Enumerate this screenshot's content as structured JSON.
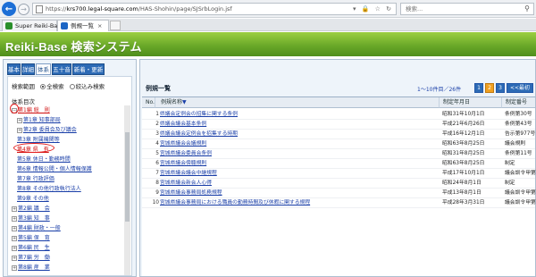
{
  "browser": {
    "url_prefix": "https://",
    "url_domain": "krs700.legal-square.com",
    "url_path": "/HAS-Shohin/page/SJSrbLogin.jsf",
    "url_tools": "▾ 🔒 ☆ ↻",
    "search_placeholder": "検索...",
    "tabs": [
      {
        "label": "Super Reiki-Base",
        "fav_color": "#2a8f2a"
      },
      {
        "label": "例規一覧",
        "fav_color": "#1c65c4"
      }
    ]
  },
  "app": {
    "title_main": "Reiki-Base",
    "title_rest": " 検索システム"
  },
  "left_panel": {
    "tabs": [
      "基本",
      "詳細",
      "体系",
      "五十音",
      "新着・更新"
    ],
    "active_tab": 2,
    "scope_label": "検索範囲",
    "scope_options": [
      "全検索",
      "絞込み検索"
    ],
    "toc_title": "体系目次",
    "tree": [
      {
        "label": "第1編 総　則",
        "expander": "−",
        "highlight": true
      },
      {
        "label": "第1章 知事部局",
        "expander": "+"
      },
      {
        "label": "第2章 委員会及び議会",
        "expander": "+"
      },
      {
        "label": "第3章 附属機関等"
      },
      {
        "label": "第4章 県　有",
        "highlight": true
      },
      {
        "label": "第5章 休日・勤務時間"
      },
      {
        "label": "第6章 情報公開・個人情報保護"
      },
      {
        "label": "第7章 行政評価"
      },
      {
        "label": "第8章 その他行政執行法人"
      },
      {
        "label": "第9章 その他"
      },
      {
        "label": "第2編 議　会",
        "expander": "+"
      },
      {
        "label": "第3編 知　事",
        "expander": "+"
      },
      {
        "label": "第4編 財政・一般",
        "expander": "+"
      },
      {
        "label": "第5編 保　育",
        "expander": "+"
      },
      {
        "label": "第6編 民　生",
        "expander": "+"
      },
      {
        "label": "第7編 労　働",
        "expander": "+"
      },
      {
        "label": "第8編 産　業",
        "expander": "+"
      }
    ]
  },
  "results": {
    "title": "例規一覧",
    "range_text": "1〜10件目／26件",
    "pages": [
      "1",
      "2",
      "3",
      "<<最初"
    ],
    "current_page": 1,
    "columns": {
      "no": "No.",
      "name": "例規名称",
      "date": "制定年月日",
      "num": "制定番号"
    },
    "rows": [
      {
        "no": "1",
        "name": "県議会定例会の招集に関する条例",
        "date": "昭和31年10月1日",
        "num": "条例第30号"
      },
      {
        "no": "2",
        "name": "県議会議会基本条例",
        "date": "平成21年6月26日",
        "num": "条例第43号"
      },
      {
        "no": "3",
        "name": "県議会議会定例会を招集する時期",
        "date": "平成16年12月1日",
        "num": "告示第977号"
      },
      {
        "no": "4",
        "name": "宮城県議会会議規則",
        "date": "昭和63年8月25日",
        "num": "議会規則"
      },
      {
        "no": "5",
        "name": "宮城県議会委員会条例",
        "date": "昭和31年8月25日",
        "num": "条例第11号"
      },
      {
        "no": "6",
        "name": "宮城県議会傍聴規則",
        "date": "昭和63年8月25日",
        "num": "制定"
      },
      {
        "no": "7",
        "name": "宮城県議会議会中継規程",
        "date": "平成17年10月1日",
        "num": "議会訓令甲第"
      },
      {
        "no": "8",
        "name": "宮城県議会新会人心得",
        "date": "昭和24年8月1日",
        "num": "制定"
      },
      {
        "no": "9",
        "name": "宮城県議会事務局処務規程",
        "date": "平成13年8月1日",
        "num": "議会訓令甲第"
      },
      {
        "no": "10",
        "name": "宮城県議会事務局における職員の勤務時間及び休暇に関する規程",
        "date": "平成28年3月31日",
        "num": "議会訓令甲第"
      }
    ]
  }
}
